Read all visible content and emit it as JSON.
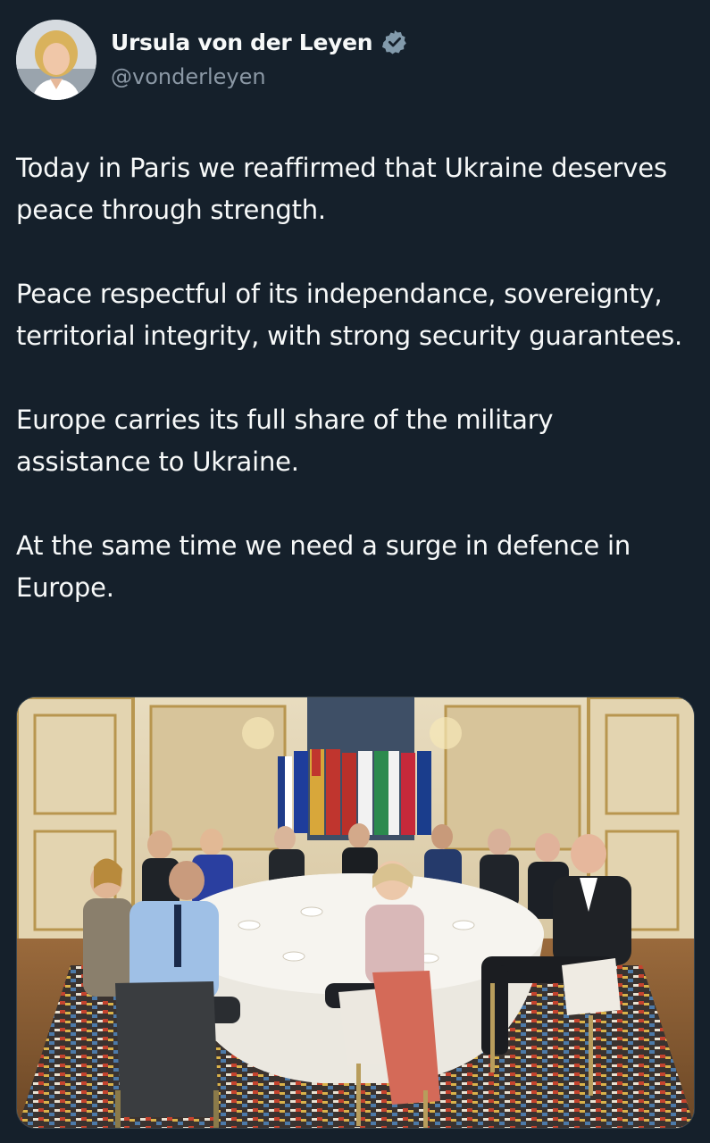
{
  "author": {
    "display_name": "Ursula von der Leyen",
    "handle": "@vonderleyen",
    "verified": true,
    "avatar_icon": "profile-photo-avatar",
    "verified_icon": "verified-badge-icon"
  },
  "tweet": {
    "paragraphs": [
      "Today in Paris we reaffirmed that Ukraine deserves peace through strength.",
      "Peace respectful of its independance, sovereignty, territorial integrity, with strong security guarantees.",
      "Europe carries its full share of the military assistance to Ukraine.",
      "At the same time we need a surge in defence in Europe."
    ]
  },
  "media": {
    "icon": "meeting-photo-image"
  },
  "colors": {
    "background": "#15202b",
    "text_primary": "#f7f9f9",
    "text_secondary": "#8b98a5",
    "verified_badge": "#829aab"
  }
}
